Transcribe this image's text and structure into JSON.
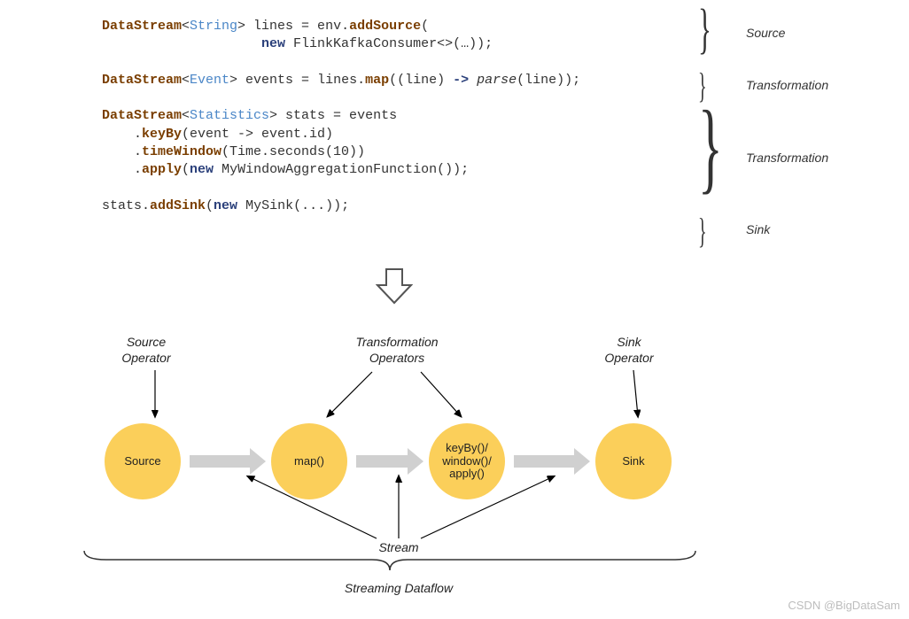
{
  "code": {
    "l1a": "DataStream",
    "l1b": "String",
    "l1c": "> lines = env.",
    "l1d": "addSource",
    "l1e": "(",
    "l2a": "                    ",
    "l2b": "new",
    "l2c": " FlinkKafkaConsumer<>(…));",
    "l3a": "DataStream",
    "l3b": "Event",
    "l3c": "> events = lines.",
    "l3d": "map",
    "l3e": "((line) ",
    "l3f": "->",
    "l3g": " ",
    "l3h": "parse",
    "l3i": "(line));",
    "l4a": "DataStream",
    "l4b": "Statistics",
    "l4c": "> stats = events",
    "l5a": "    .",
    "l5b": "keyBy",
    "l5c": "(event -> event.id)",
    "l6a": "    .",
    "l6b": "timeWindow",
    "l6c": "(Time.seconds(10))",
    "l7a": "    .",
    "l7b": "apply",
    "l7c": "(",
    "l7d": "new",
    "l7e": " MyWindowAggregationFunction());",
    "l8a": "stats.",
    "l8b": "addSink",
    "l8c": "(",
    "l8d": "new",
    "l8e": " MySink(...));"
  },
  "labels": {
    "source": "Source",
    "transformation": "Transformation",
    "sink": "Sink",
    "source_op": "Source\nOperator",
    "trans_ops": "Transformation\nOperators",
    "sink_op": "Sink\nOperator",
    "stream": "Stream",
    "dataflow": "Streaming Dataflow"
  },
  "nodes": {
    "source": "Source",
    "map": "map()",
    "kwa": "keyBy()/\nwindow()/\napply()",
    "sink": "Sink"
  },
  "watermark": "CSDN @BigDataSam"
}
